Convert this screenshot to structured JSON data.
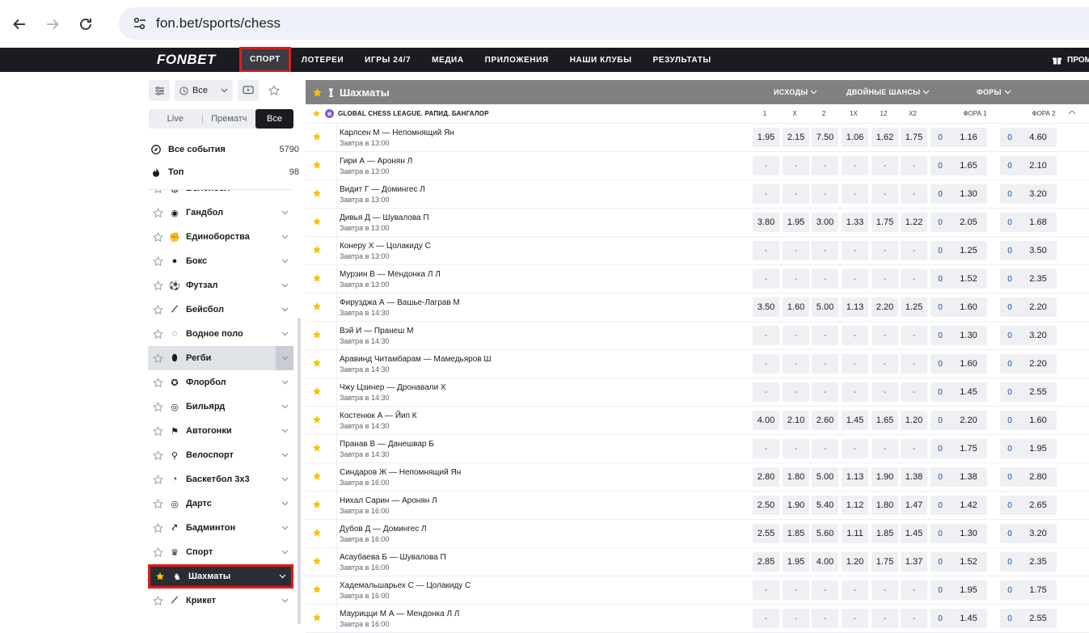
{
  "browser": {
    "url": "fon.bet/sports/chess"
  },
  "site": {
    "logo": "FONBET",
    "menu": [
      "СПОРТ",
      "ЛОТЕРЕИ",
      "ИГРЫ 24/7",
      "МЕДИА",
      "ПРИЛОЖЕНИЯ",
      "НАШИ КЛУБЫ",
      "РЕЗУЛЬТАТЫ"
    ],
    "promo": "ПРОМ"
  },
  "sidebar": {
    "time_filter": "Все",
    "segments": [
      "Live",
      "Прематч",
      "Все"
    ],
    "all_events": {
      "label": "Все события",
      "count": "5790"
    },
    "top": {
      "label": "Топ",
      "count": "98"
    },
    "sports": [
      {
        "label": "Волейбол",
        "icon": "volleyball-icon"
      },
      {
        "label": "Гандбол",
        "icon": "handball-icon"
      },
      {
        "label": "Единоборства",
        "icon": "martial-arts-icon"
      },
      {
        "label": "Бокс",
        "icon": "boxing-icon"
      },
      {
        "label": "Футзал",
        "icon": "futsal-icon"
      },
      {
        "label": "Бейсбол",
        "icon": "baseball-icon"
      },
      {
        "label": "Водное поло",
        "icon": "water-polo-icon"
      },
      {
        "label": "Регби",
        "icon": "rugby-icon"
      },
      {
        "label": "Флорбол",
        "icon": "floorball-icon"
      },
      {
        "label": "Бильярд",
        "icon": "billiards-icon"
      },
      {
        "label": "Автогонки",
        "icon": "racing-flag-icon"
      },
      {
        "label": "Велоспорт",
        "icon": "bicycle-icon"
      },
      {
        "label": "Баскетбол 3х3",
        "icon": "basketball-3x3-icon"
      },
      {
        "label": "Дартс",
        "icon": "darts-icon"
      },
      {
        "label": "Бадминтон",
        "icon": "badminton-icon"
      },
      {
        "label": "Спорт",
        "icon": "trophy-icon"
      },
      {
        "label": "Шахматы",
        "icon": "chess-icon"
      },
      {
        "label": "Крикет",
        "icon": "cricket-icon"
      }
    ]
  },
  "main": {
    "title": "Шахматы",
    "groups": [
      "ИСХОДЫ",
      "ДВОЙНЫЕ ШАНСЫ",
      "ФОРЫ"
    ],
    "league": "GLOBAL CHESS LEAGUE. РАПИД. БАНГАЛОР",
    "columns": [
      "1",
      "X",
      "2",
      "1X",
      "12",
      "X2",
      "ФОРА 1",
      "ФОРА 2"
    ],
    "matches": [
      {
        "name": "Карлсен М — Непомнящий Ян",
        "time": "Завтра в 13:00",
        "odds": [
          "1.95",
          "2.15",
          "7.50",
          "1.06",
          "1.62",
          "1.75"
        ],
        "f1h": "0",
        "f1": "1.16",
        "f2h": "0",
        "f2": "4.60"
      },
      {
        "name": "Гири А — Аронян Л",
        "time": "Завтра в 13:00",
        "odds": [
          "-",
          "-",
          "-",
          "-",
          "-",
          "-"
        ],
        "f1h": "0",
        "f1": "1.65",
        "f2h": "0",
        "f2": "2.10"
      },
      {
        "name": "Видит Г — Домингес Л",
        "time": "Завтра в 13:00",
        "odds": [
          "-",
          "-",
          "-",
          "-",
          "-",
          "-"
        ],
        "f1h": "0",
        "f1": "1.30",
        "f2h": "0",
        "f2": "3.20"
      },
      {
        "name": "Дивья Д — Шувалова П",
        "time": "Завтра в 13:00",
        "odds": [
          "3.80",
          "1.95",
          "3.00",
          "1.33",
          "1.75",
          "1.22"
        ],
        "f1h": "0",
        "f1": "2.05",
        "f2h": "0",
        "f2": "1.68"
      },
      {
        "name": "Конеру Х — Цолакиду С",
        "time": "Завтра в 13:00",
        "odds": [
          "-",
          "-",
          "-",
          "-",
          "-",
          "-"
        ],
        "f1h": "0",
        "f1": "1.25",
        "f2h": "0",
        "f2": "3.50"
      },
      {
        "name": "Мурзин В — Мендонка Л Л",
        "time": "Завтра в 13:00",
        "odds": [
          "-",
          "-",
          "-",
          "-",
          "-",
          "-"
        ],
        "f1h": "0",
        "f1": "1.52",
        "f2h": "0",
        "f2": "2.35"
      },
      {
        "name": "Фирузджа А — Вашье-Лаграв М",
        "time": "Завтра в 14:30",
        "odds": [
          "3.50",
          "1.60",
          "5.00",
          "1.13",
          "2.20",
          "1.25"
        ],
        "f1h": "0",
        "f1": "1.60",
        "f2h": "0",
        "f2": "2.20"
      },
      {
        "name": "Вэй И — Пранеш М",
        "time": "Завтра в 14:30",
        "odds": [
          "-",
          "-",
          "-",
          "-",
          "-",
          "-"
        ],
        "f1h": "0",
        "f1": "1.30",
        "f2h": "0",
        "f2": "3.20"
      },
      {
        "name": "Аравинд Читамбарам — Мамедьяров Ш",
        "time": "Завтра в 14:30",
        "odds": [
          "-",
          "-",
          "-",
          "-",
          "-",
          "-"
        ],
        "f1h": "0",
        "f1": "1.60",
        "f2h": "0",
        "f2": "2.20"
      },
      {
        "name": "Чжу Цзинер — Дронавали Х",
        "time": "Завтра в 14:30",
        "odds": [
          "-",
          "-",
          "-",
          "-",
          "-",
          "-"
        ],
        "f1h": "0",
        "f1": "1.45",
        "f2h": "0",
        "f2": "2.55"
      },
      {
        "name": "Костенюк А — Йип К",
        "time": "Завтра в 14:30",
        "odds": [
          "4.00",
          "2.10",
          "2.60",
          "1.45",
          "1.65",
          "1.20"
        ],
        "f1h": "0",
        "f1": "2.20",
        "f2h": "0",
        "f2": "1.60"
      },
      {
        "name": "Пранав В — Данешвар Б",
        "time": "Завтра в 14:30",
        "odds": [
          "-",
          "-",
          "-",
          "-",
          "-",
          "-"
        ],
        "f1h": "0",
        "f1": "1.75",
        "f2h": "0",
        "f2": "1.95"
      },
      {
        "name": "Синдаров Ж — Непомнящий Ян",
        "time": "Завтра в 16:00",
        "odds": [
          "2.80",
          "1.80",
          "5.00",
          "1.13",
          "1.90",
          "1.38"
        ],
        "f1h": "0",
        "f1": "1.38",
        "f2h": "0",
        "f2": "2.80"
      },
      {
        "name": "Нихал Сарин — Аронян Л",
        "time": "Завтра в 16:00",
        "odds": [
          "2.50",
          "1.90",
          "5.40",
          "1.12",
          "1.80",
          "1.47"
        ],
        "f1h": "0",
        "f1": "1.42",
        "f2h": "0",
        "f2": "2.65"
      },
      {
        "name": "Дубов Д — Домингес Л",
        "time": "Завтра в 16:00",
        "odds": [
          "2.55",
          "1.85",
          "5.60",
          "1.11",
          "1.85",
          "1.45"
        ],
        "f1h": "0",
        "f1": "1.30",
        "f2h": "0",
        "f2": "3.20"
      },
      {
        "name": "Асаубаева Б — Шувалова П",
        "time": "Завтра в 16:00",
        "odds": [
          "2.85",
          "1.95",
          "4.00",
          "1.20",
          "1.75",
          "1.37"
        ],
        "f1h": "0",
        "f1": "1.52",
        "f2h": "0",
        "f2": "2.35"
      },
      {
        "name": "Хадемальшарьех С — Цолакиду С",
        "time": "Завтра в 16:00",
        "odds": [
          "-",
          "-",
          "-",
          "-",
          "-",
          "-"
        ],
        "f1h": "0",
        "f1": "1.95",
        "f2h": "0",
        "f2": "1.75"
      },
      {
        "name": "Маурицци М А — Мендонка Л Л",
        "time": "Завтра в 16:00",
        "odds": [
          "-",
          "-",
          "-",
          "-",
          "-",
          "-"
        ],
        "f1h": "0",
        "f1": "1.45",
        "f2h": "0",
        "f2": "2.55"
      }
    ]
  },
  "colors": {
    "accent_red": "#e11b1b",
    "star_yellow": "#f5c400",
    "nav_dark": "#1a1c21",
    "header_gray": "#818181"
  }
}
